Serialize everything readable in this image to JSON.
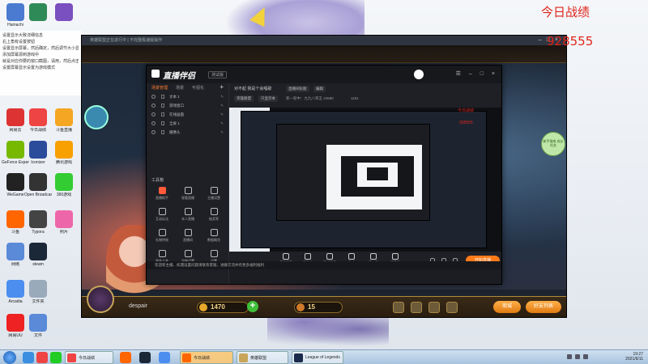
{
  "overlay": {
    "today_record": "今日战绩",
    "record_count": "928555"
  },
  "desktop_icons": [
    {
      "label": "Hamachi",
      "color": "#4a7bd0"
    },
    {
      "label": "",
      "color": "#2e8b57"
    },
    {
      "label": "",
      "color": "#7a4fc0"
    },
    {
      "label": "网易云",
      "color": "#d33"
    },
    {
      "label": "今日战绩",
      "color": "#e44"
    },
    {
      "label": "斗鱼直播",
      "color": "#f5a623"
    },
    {
      "label": "GeForce Experience",
      "color": "#76b900"
    },
    {
      "label": "Iconizer",
      "color": "#2b4c9a"
    },
    {
      "label": "腾讯游戏",
      "color": "#f7a000"
    },
    {
      "label": "WeGame",
      "color": "#222"
    },
    {
      "label": "Open Broadcaster",
      "color": "#333"
    },
    {
      "label": "360游戏",
      "color": "#3c3"
    },
    {
      "label": "斗鱼",
      "color": "#f60"
    },
    {
      "label": "Typora",
      "color": "#444"
    },
    {
      "label": "照片",
      "color": "#e6a"
    },
    {
      "label": "网络",
      "color": "#5a8ad8"
    },
    {
      "label": "steam",
      "color": "#1b2838"
    },
    {
      "label": "Arcadia",
      "color": "#4b8ef0"
    },
    {
      "label": "文件夹",
      "color": "#9ab"
    },
    {
      "label": "网易UU",
      "color": "#e22"
    },
    {
      "label": "文件",
      "color": "#5a8ad8"
    }
  ],
  "notice": [
    "设置显示大致详细信息",
    "右上角有设置按钮",
    "设置显示屏幕，然后确定，然后调节大小显示",
    "添加屏幕源到游戏中",
    "就是对应你要的窗口截图，请用，然后点击保存",
    "设置屏幕显示设置为游戏模式"
  ],
  "game": {
    "title": "英雄联盟正在进行中 | 不完整极速版操作",
    "player_name": "despair",
    "blue_essence": "1470",
    "rp": "15",
    "btn_shop": "商城",
    "btn_friends": "好友列表",
    "side_badge": "新手指南 成长任务"
  },
  "stream": {
    "app_title": "直播伴侣",
    "beta_tag": "测试版",
    "tabs": {
      "scenes": "场景管理",
      "scene2": "场景",
      "layers": "可视化"
    },
    "sources": [
      {
        "name": "文本 1",
        "action": "✎"
      },
      {
        "name": "游戏窗口",
        "action": "✎"
      },
      {
        "name": "在线画面",
        "action": "✎"
      },
      {
        "name": "全屏 1",
        "action": "✎"
      },
      {
        "name": "摄像头",
        "action": "✎"
      }
    ],
    "tools_title": "工具箱",
    "tools": [
      {
        "label": "直播助手",
        "hot": true
      },
      {
        "label": "观看直播"
      },
      {
        "label": "主播设置"
      },
      {
        "label": "互动玩法"
      },
      {
        "label": "本人直播"
      },
      {
        "label": "抽奖等"
      },
      {
        "label": "礼物特效"
      },
      {
        "label": "直播间"
      },
      {
        "label": "数据概览"
      },
      {
        "label": "更多工具"
      },
      {
        "label": "录制设置"
      },
      {
        "label": "设置"
      }
    ],
    "top_line1": "对不起 我是个会唱歌",
    "top_tag1": "直播间标题",
    "top_tag1b": "编辑",
    "top_tag2": "英雄联盟",
    "top_tag3": "只显示本",
    "top_line2": "新一轮中：九九八荣王 23580",
    "top_online": "1181",
    "bottom_tools": [
      {
        "label": "直播画面"
      },
      {
        "label": "摄像头"
      },
      {
        "label": "手机直播"
      },
      {
        "label": "游戏"
      },
      {
        "label": "麦克风"
      },
      {
        "label": "扬声器"
      }
    ],
    "start_live": "开始直播",
    "notice": "欢迎新主播，如遇设置问题请联系客服，进群交流并有更多福利福利"
  },
  "preview": {
    "today_record": "今日战绩",
    "record_count": "928555"
  },
  "taskbar": {
    "tasks": [
      {
        "label": "今日战绩",
        "color": "#e44"
      },
      {
        "label": "今日战绩",
        "color": "#f60",
        "active": true
      },
      {
        "label": "英雄联盟",
        "color": "#c7a55a"
      },
      {
        "label": "League of Legends",
        "color": "#1a2a4a"
      }
    ],
    "time": "19:27",
    "date": "2021/6/11"
  }
}
